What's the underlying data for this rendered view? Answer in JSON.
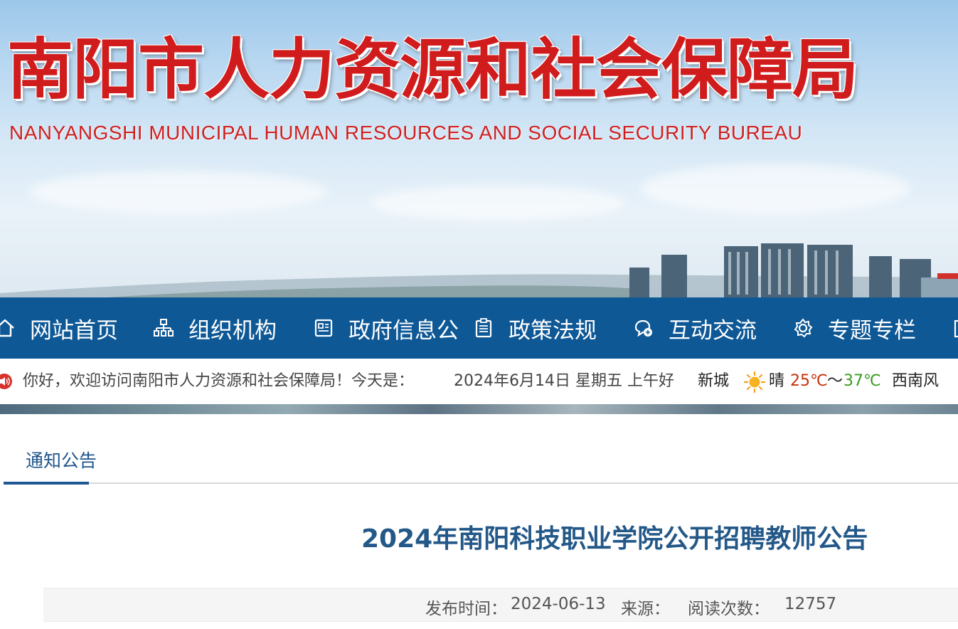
{
  "header": {
    "title": "南阳市人力资源和社会保障局",
    "subtitle": "NANYANGSHI MUNICIPAL HUMAN RESOURCES AND SOCIAL SECURITY BUREAU"
  },
  "nav": {
    "items": [
      {
        "label": "网站首页",
        "icon": "home-icon"
      },
      {
        "label": "组织机构",
        "icon": "org-chart-icon"
      },
      {
        "label": "政府信息公",
        "icon": "info-icon"
      },
      {
        "label": "政策法规",
        "icon": "clipboard-icon"
      },
      {
        "label": "互动交流",
        "icon": "chat-icon"
      },
      {
        "label": "专题专栏",
        "icon": "gear-icon"
      }
    ]
  },
  "welcome": {
    "greeting": "你好，欢迎访问南阳市人力资源和社会保障局！今天是：",
    "date": "2024年6月14日 星期五 上午好",
    "city": "新城",
    "weather": "晴",
    "temp_low": "25℃",
    "tilde": "～",
    "temp_high": "37℃",
    "wind": "西南风"
  },
  "section": {
    "tab_label": "通知公告"
  },
  "article": {
    "title": "2024年南阳科技职业学院公开招聘教师公告",
    "publish_label": "发布时间：",
    "publish_date": "2024-06-13",
    "source_label": "来源：",
    "read_label": "阅读次数：",
    "read_count": "12757"
  },
  "colors": {
    "nav_bg": "#0e5896",
    "title_red": "#d01c1c",
    "article_title": "#235888",
    "temp_low": "#c8310d",
    "temp_high": "#3a9c1d"
  }
}
